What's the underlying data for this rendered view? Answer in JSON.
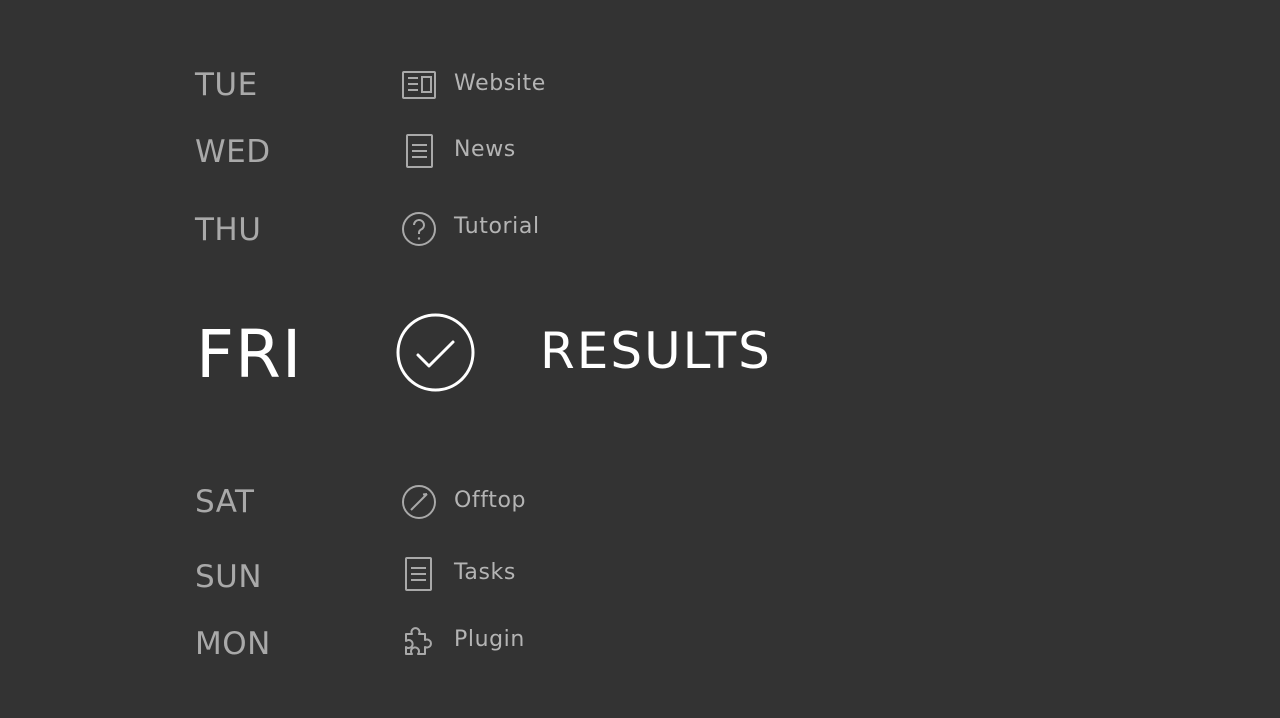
{
  "schedule": {
    "items": [
      {
        "day": "TUE",
        "label": "Website",
        "icon": "website-icon"
      },
      {
        "day": "WED",
        "label": "News",
        "icon": "document-icon"
      },
      {
        "day": "THU",
        "label": "Tutorial",
        "icon": "question-icon"
      },
      {
        "day": "FRI",
        "label": "RESULTS",
        "icon": "check-circle-icon"
      },
      {
        "day": "SAT",
        "label": "Offtop",
        "icon": "compass-icon"
      },
      {
        "day": "SUN",
        "label": "Tasks",
        "icon": "document-icon"
      },
      {
        "day": "MON",
        "label": "Plugin",
        "icon": "puzzle-icon"
      }
    ],
    "active_index": 3
  },
  "colors": {
    "background": "#333333",
    "inactive_text": "#a9a9a9",
    "active_text": "#ffffff"
  }
}
